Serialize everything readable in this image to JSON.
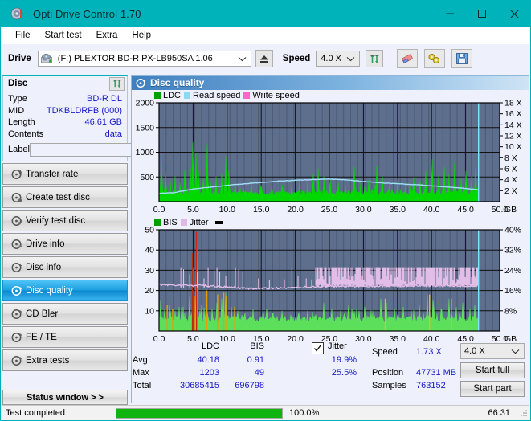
{
  "window": {
    "title": "Opti Drive Control 1.70",
    "app_icon": "disc-icon",
    "minimize": "─",
    "maximize": "☐",
    "close": "✕",
    "titlebar_color": "#00b3ba"
  },
  "menu": {
    "items": [
      {
        "label": "File"
      },
      {
        "label": "Start test"
      },
      {
        "label": "Extra"
      },
      {
        "label": "Help"
      }
    ]
  },
  "toolbar": {
    "drive_label": "Drive",
    "drive_value": "(F:)  PLEXTOR BD-R  PX-LB950SA 1.06",
    "drive_icon": "drive-icon",
    "eject_icon": "eject-icon",
    "speed_label": "Speed",
    "speed_value": "4.0 X",
    "refresh_icon": "refresh-icon",
    "erase_icon": "eraser-icon",
    "tools_icon": "tools-icon",
    "save_icon": "save-icon",
    "chevron": "∨"
  },
  "disc_panel": {
    "title": "Disc",
    "refresh_icon": "refresh-icon",
    "rows": [
      {
        "key": "Type",
        "value": "BD-R DL"
      },
      {
        "key": "MID",
        "value": "TDKBLDRFB (000)"
      },
      {
        "key": "Length",
        "value": "46.61 GB"
      },
      {
        "key": "Contents",
        "value": "data"
      }
    ],
    "label_key": "Label",
    "label_value": "",
    "label_placeholder": "",
    "label_button_icon": "disc-label-icon"
  },
  "nav": {
    "items": [
      {
        "label": "Transfer rate",
        "icon": "disc-transfer-icon",
        "active": false
      },
      {
        "label": "Create test disc",
        "icon": "disc-create-icon",
        "active": false
      },
      {
        "label": "Verify test disc",
        "icon": "disc-verify-icon",
        "active": false
      },
      {
        "label": "Drive info",
        "icon": "drive-info-icon",
        "active": false
      },
      {
        "label": "Disc info",
        "icon": "disc-info-icon",
        "active": false
      },
      {
        "label": "Disc quality",
        "icon": "disc-quality-icon",
        "active": true
      },
      {
        "label": "CD Bler",
        "icon": "cd-bler-icon",
        "active": false
      },
      {
        "label": "FE / TE",
        "icon": "fe-te-icon",
        "active": false
      },
      {
        "label": "Extra tests",
        "icon": "extra-tests-icon",
        "active": false
      }
    ],
    "status_window": "Status window > >"
  },
  "content": {
    "header_title": "Disc quality",
    "header_icon": "disc-quality-icon"
  },
  "chart_data": [
    {
      "type": "area",
      "name": "ldc-chart",
      "title": "",
      "xlabel": "GB",
      "ylabel": "",
      "xlim": [
        0,
        50
      ],
      "ylim": [
        0,
        2000
      ],
      "y2lim": [
        0,
        18
      ],
      "xticks": [
        "0.0",
        "5.0",
        "10.0",
        "15.0",
        "20.0",
        "25.0",
        "30.0",
        "35.0",
        "40.0",
        "45.0",
        "50.0"
      ],
      "yticks": [
        "500",
        "1000",
        "1500",
        "2000"
      ],
      "y2ticks": [
        "2 X",
        "4 X",
        "6 X",
        "8 X",
        "10 X",
        "12 X",
        "14 X",
        "16 X",
        "18 X"
      ],
      "x_unit": "GB",
      "legend": [
        {
          "label": "LDC",
          "color": "#00a000"
        },
        {
          "label": "Read speed",
          "color": "#8fd8f4"
        },
        {
          "label": "Write speed",
          "color": "#ff66cc"
        }
      ],
      "data_end_gb": 46.9,
      "plot_bg": "#5d6f8c",
      "grid": true,
      "series": [
        {
          "name": "LDC",
          "color": "#00d800",
          "kind": "area",
          "baseline": 120,
          "noise": 90,
          "spikes": [
            {
              "x": 0.4,
              "y": 980
            },
            {
              "x": 0.9,
              "y": 600
            },
            {
              "x": 1.6,
              "y": 420
            },
            {
              "x": 2.4,
              "y": 520
            },
            {
              "x": 3.1,
              "y": 380
            },
            {
              "x": 3.8,
              "y": 650
            },
            {
              "x": 4.6,
              "y": 700
            },
            {
              "x": 5.0,
              "y": 1203
            },
            {
              "x": 5.4,
              "y": 980
            },
            {
              "x": 5.8,
              "y": 640
            },
            {
              "x": 6.5,
              "y": 460
            },
            {
              "x": 7.1,
              "y": 1140
            },
            {
              "x": 7.6,
              "y": 410
            },
            {
              "x": 8.4,
              "y": 520
            },
            {
              "x": 9.2,
              "y": 560
            },
            {
              "x": 9.8,
              "y": 920
            },
            {
              "x": 10.3,
              "y": 640
            },
            {
              "x": 11.2,
              "y": 360
            },
            {
              "x": 12.4,
              "y": 300
            },
            {
              "x": 13.6,
              "y": 420
            },
            {
              "x": 15.0,
              "y": 330
            },
            {
              "x": 16.5,
              "y": 280
            },
            {
              "x": 18.1,
              "y": 350
            },
            {
              "x": 19.4,
              "y": 300
            },
            {
              "x": 20.6,
              "y": 460
            },
            {
              "x": 21.8,
              "y": 410
            },
            {
              "x": 22.6,
              "y": 560
            },
            {
              "x": 23.3,
              "y": 680
            },
            {
              "x": 24.2,
              "y": 520
            },
            {
              "x": 25.1,
              "y": 460
            },
            {
              "x": 26.3,
              "y": 400
            },
            {
              "x": 27.4,
              "y": 340
            },
            {
              "x": 28.6,
              "y": 700
            },
            {
              "x": 29.6,
              "y": 380
            },
            {
              "x": 30.8,
              "y": 440
            },
            {
              "x": 31.9,
              "y": 720
            },
            {
              "x": 32.8,
              "y": 520
            },
            {
              "x": 33.9,
              "y": 400
            },
            {
              "x": 35.0,
              "y": 470
            },
            {
              "x": 36.2,
              "y": 380
            },
            {
              "x": 37.4,
              "y": 500
            },
            {
              "x": 38.3,
              "y": 420
            },
            {
              "x": 39.2,
              "y": 620
            },
            {
              "x": 40.1,
              "y": 860
            },
            {
              "x": 41.0,
              "y": 520
            },
            {
              "x": 41.9,
              "y": 700
            },
            {
              "x": 42.6,
              "y": 560
            },
            {
              "x": 43.4,
              "y": 800
            },
            {
              "x": 44.3,
              "y": 460
            },
            {
              "x": 45.1,
              "y": 620
            },
            {
              "x": 45.9,
              "y": 520
            },
            {
              "x": 46.5,
              "y": 700
            }
          ]
        },
        {
          "name": "Read speed",
          "color": "#9fdff8",
          "kind": "line",
          "points": [
            {
              "x": 0.0,
              "y": 1.55
            },
            {
              "x": 2.0,
              "y": 1.6
            },
            {
              "x": 5.0,
              "y": 2.3
            },
            {
              "x": 8.0,
              "y": 2.7
            },
            {
              "x": 11.0,
              "y": 3.1
            },
            {
              "x": 14.0,
              "y": 3.4
            },
            {
              "x": 17.0,
              "y": 3.7
            },
            {
              "x": 20.0,
              "y": 3.9
            },
            {
              "x": 23.0,
              "y": 4.05
            },
            {
              "x": 25.0,
              "y": 4.1
            },
            {
              "x": 27.0,
              "y": 4.0
            },
            {
              "x": 30.0,
              "y": 3.7
            },
            {
              "x": 33.0,
              "y": 3.4
            },
            {
              "x": 36.0,
              "y": 3.2
            },
            {
              "x": 39.0,
              "y": 3.0
            },
            {
              "x": 42.0,
              "y": 2.7
            },
            {
              "x": 45.0,
              "y": 2.4
            },
            {
              "x": 46.8,
              "y": 2.2
            }
          ],
          "end_vertical_to": 18
        }
      ]
    },
    {
      "type": "area",
      "name": "bis-jitter-chart",
      "title": "",
      "xlabel": "GB",
      "ylabel": "",
      "xlim": [
        0,
        50
      ],
      "ylim": [
        0,
        50
      ],
      "y2lim": [
        0,
        40
      ],
      "xticks": [
        "0.0",
        "5.0",
        "10.0",
        "15.0",
        "20.0",
        "25.0",
        "30.0",
        "35.0",
        "40.0",
        "45.0",
        "50.0"
      ],
      "yticks": [
        "10",
        "20",
        "30",
        "40",
        "50"
      ],
      "y2ticks": [
        "8%",
        "16%",
        "24%",
        "32%",
        "40%"
      ],
      "x_unit": "GB",
      "legend": [
        {
          "label": "BIS",
          "color": "#00a000"
        },
        {
          "label": "Jitter",
          "color": "#e0b8e8"
        },
        {
          "label": "",
          "color": "#000000"
        }
      ],
      "data_end_gb": 46.9,
      "plot_bg": "#5d6f8c",
      "grid": true,
      "series": [
        {
          "name": "BIS",
          "color": "#5ce05c",
          "kind": "area",
          "baseline": 4.2,
          "noise": 3.4,
          "spikes": [
            {
              "x": 0.2,
              "y": 15
            },
            {
              "x": 0.8,
              "y": 11
            },
            {
              "x": 1.5,
              "y": 13
            },
            {
              "x": 2.3,
              "y": 10
            },
            {
              "x": 3.0,
              "y": 12
            },
            {
              "x": 3.8,
              "y": 9
            },
            {
              "x": 4.5,
              "y": 17
            },
            {
              "x": 5.0,
              "y": 20
            },
            {
              "x": 5.5,
              "y": 49
            },
            {
              "x": 6.2,
              "y": 13
            },
            {
              "x": 7.0,
              "y": 18
            },
            {
              "x": 7.8,
              "y": 11
            },
            {
              "x": 8.5,
              "y": 14
            },
            {
              "x": 9.2,
              "y": 16
            },
            {
              "x": 9.8,
              "y": 19
            },
            {
              "x": 10.6,
              "y": 12
            },
            {
              "x": 11.5,
              "y": 10
            },
            {
              "x": 12.6,
              "y": 9
            },
            {
              "x": 13.8,
              "y": 11
            },
            {
              "x": 15.2,
              "y": 8
            },
            {
              "x": 16.6,
              "y": 9
            },
            {
              "x": 18.0,
              "y": 10
            },
            {
              "x": 19.3,
              "y": 8
            },
            {
              "x": 20.5,
              "y": 9
            },
            {
              "x": 21.8,
              "y": 10
            },
            {
              "x": 23.0,
              "y": 8
            },
            {
              "x": 24.2,
              "y": 14
            },
            {
              "x": 25.4,
              "y": 11
            },
            {
              "x": 26.6,
              "y": 10
            },
            {
              "x": 27.8,
              "y": 13
            },
            {
              "x": 29.0,
              "y": 11
            },
            {
              "x": 30.2,
              "y": 12
            },
            {
              "x": 31.4,
              "y": 10
            },
            {
              "x": 32.6,
              "y": 16
            },
            {
              "x": 33.4,
              "y": 14
            },
            {
              "x": 34.6,
              "y": 11
            },
            {
              "x": 35.8,
              "y": 12
            },
            {
              "x": 37.0,
              "y": 10
            },
            {
              "x": 38.2,
              "y": 13
            },
            {
              "x": 39.4,
              "y": 18
            },
            {
              "x": 40.2,
              "y": 15
            },
            {
              "x": 41.4,
              "y": 11
            },
            {
              "x": 42.6,
              "y": 16
            },
            {
              "x": 43.6,
              "y": 12
            },
            {
              "x": 44.6,
              "y": 14
            },
            {
              "x": 45.6,
              "y": 11
            },
            {
              "x": 46.4,
              "y": 13
            }
          ]
        },
        {
          "name": "Jitter",
          "color": "#e2bde8",
          "kind": "line",
          "baseline_low": 21.5,
          "band_high": 31.5,
          "dense_from_gb": 23.0,
          "points": [
            {
              "x": 0.0,
              "y": 23.0
            },
            {
              "x": 2.0,
              "y": 22.6
            },
            {
              "x": 4.0,
              "y": 22.7
            },
            {
              "x": 6.0,
              "y": 22.4
            },
            {
              "x": 8.0,
              "y": 22.2
            },
            {
              "x": 10.0,
              "y": 21.8
            },
            {
              "x": 12.0,
              "y": 21.2
            },
            {
              "x": 14.0,
              "y": 21.0
            },
            {
              "x": 16.0,
              "y": 21.1
            },
            {
              "x": 18.0,
              "y": 21.3
            },
            {
              "x": 20.0,
              "y": 21.5
            },
            {
              "x": 22.0,
              "y": 21.7
            },
            {
              "x": 24.0,
              "y": 22.0
            },
            {
              "x": 28.0,
              "y": 22.1
            },
            {
              "x": 32.0,
              "y": 22.2
            },
            {
              "x": 36.0,
              "y": 22.3
            },
            {
              "x": 40.0,
              "y": 22.4
            },
            {
              "x": 44.0,
              "y": 22.3
            },
            {
              "x": 46.8,
              "y": 22.3
            }
          ]
        }
      ]
    }
  ],
  "stats": {
    "col_headers": {
      "ldc": "LDC",
      "bis": "BIS",
      "jitter": "Jitter"
    },
    "row_labels": {
      "avg": "Avg",
      "max": "Max",
      "total": "Total"
    },
    "ldc": {
      "avg": "40.18",
      "max": "1203",
      "total": "30685415"
    },
    "bis": {
      "avg": "0.91",
      "max": "49",
      "total": "696798"
    },
    "jitter": {
      "checked": true,
      "avg": "19.9%",
      "max": "25.5%"
    },
    "speed_label": "Speed",
    "speed_value": "1.73 X",
    "position_label": "Position",
    "position_value": "47731 MB",
    "samples_label": "Samples",
    "samples_value": "763152",
    "speed_select": "4.0 X",
    "start_full": "Start full",
    "start_part": "Start part"
  },
  "statusbar": {
    "message": "Test completed",
    "progress_percent": 100.0,
    "progress_text": "100.0%",
    "elapsed": "66:31",
    "progress_color": "#0fb40f"
  }
}
